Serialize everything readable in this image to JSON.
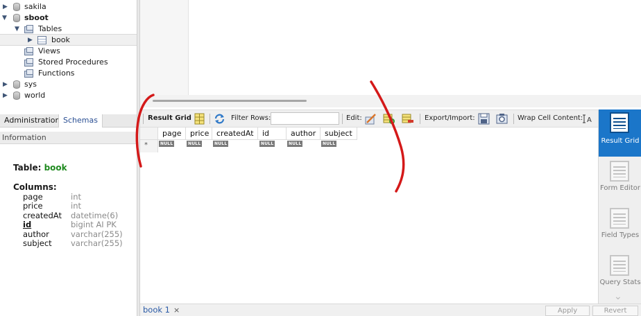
{
  "navigator": {
    "schemas": [
      {
        "name": "sakila",
        "expanded": false
      },
      {
        "name": "sboot",
        "expanded": true
      },
      {
        "name": "sys",
        "expanded": false
      },
      {
        "name": "world",
        "expanded": false
      }
    ],
    "sboot_children": {
      "tables_label": "Tables",
      "table_item": "book",
      "views_label": "Views",
      "procs_label": "Stored Procedures",
      "functions_label": "Functions"
    },
    "tabs": {
      "administration": "Administration",
      "schemas": "Schemas"
    },
    "info_header": "Information",
    "info": {
      "table_prefix": "Table:",
      "table_name": "book",
      "columns_title": "Columns:",
      "columns": [
        {
          "name": "page",
          "type": "int"
        },
        {
          "name": "price",
          "type": "int"
        },
        {
          "name": "createdAt",
          "type": "datetime(6)"
        },
        {
          "name": "id",
          "type": "bigint AI PK"
        },
        {
          "name": "author",
          "type": "varchar(255)"
        },
        {
          "name": "subject",
          "type": "varchar(255)"
        }
      ]
    }
  },
  "toolbar": {
    "result_grid": "Result Grid",
    "filter_rows": "Filter Rows:",
    "filter_value": "",
    "edit": "Edit:",
    "export_import": "Export/Import:",
    "wrap_cell": "Wrap Cell Content:"
  },
  "grid": {
    "columns": [
      "page",
      "price",
      "createdAt",
      "id",
      "author",
      "subject"
    ],
    "null_text": "NULL",
    "new_row_marker": "*"
  },
  "side_panel": [
    {
      "label": "Result Grid",
      "active": true
    },
    {
      "label": "Form Editor",
      "active": false
    },
    {
      "label": "Field Types",
      "active": false
    },
    {
      "label": "Query Stats",
      "active": false
    }
  ],
  "bottom": {
    "tab_label": "book 1",
    "close_glyph": "×",
    "apply": "Apply",
    "revert": "Revert"
  },
  "colors": {
    "accent": "#1b76c9",
    "table_name_green": "#1f8a1f",
    "annotation_red": "#d41919"
  }
}
